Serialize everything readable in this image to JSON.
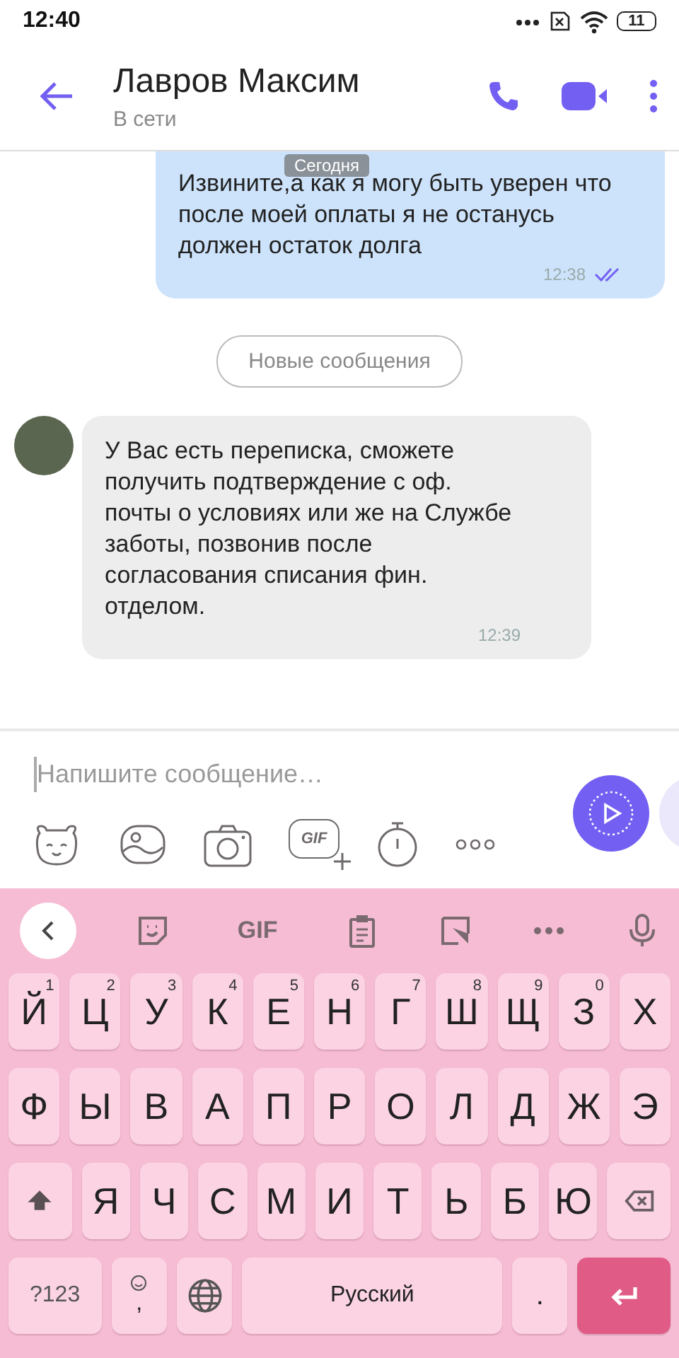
{
  "status_bar": {
    "time": "12:40",
    "battery": "11"
  },
  "header": {
    "title": "Лавров Максим",
    "subtitle": "В сети"
  },
  "date_badge": "Сегодня",
  "messages": [
    {
      "kind": "outgoing",
      "text": "Извините,а как я могу быть уверен что после моей оплаты я не останусь должен остаток долга",
      "time": "12:38",
      "read": true
    },
    {
      "kind": "divider",
      "text": "Новые сообщения"
    },
    {
      "kind": "incoming",
      "text": "У Вас есть переписка, сможете получить подтверждение с оф. почты о условиях или же на Службе заботы, позвонив после согласования списания фин. отделом.",
      "time": "12:39"
    }
  ],
  "composer": {
    "placeholder": "Напишите сообщение…",
    "gif_label": "GIF"
  },
  "keyboard": {
    "toolbar_gif": "GIF",
    "rows": [
      {
        "keys": [
          {
            "kind": "char",
            "label": "Й",
            "hint": "1"
          },
          {
            "kind": "char",
            "label": "Ц",
            "hint": "2"
          },
          {
            "kind": "char",
            "label": "У",
            "hint": "3"
          },
          {
            "kind": "char",
            "label": "К",
            "hint": "4"
          },
          {
            "kind": "char",
            "label": "Е",
            "hint": "5"
          },
          {
            "kind": "char",
            "label": "Н",
            "hint": "6"
          },
          {
            "kind": "char",
            "label": "Г",
            "hint": "7"
          },
          {
            "kind": "char",
            "label": "Ш",
            "hint": "8"
          },
          {
            "kind": "char",
            "label": "Щ",
            "hint": "9"
          },
          {
            "kind": "char",
            "label": "З",
            "hint": "0"
          },
          {
            "kind": "char",
            "label": "Х"
          }
        ]
      },
      {
        "keys": [
          {
            "kind": "char",
            "label": "Ф"
          },
          {
            "kind": "char",
            "label": "Ы"
          },
          {
            "kind": "char",
            "label": "В"
          },
          {
            "kind": "char",
            "label": "А"
          },
          {
            "kind": "char",
            "label": "П"
          },
          {
            "kind": "char",
            "label": "Р"
          },
          {
            "kind": "char",
            "label": "О"
          },
          {
            "kind": "char",
            "label": "Л"
          },
          {
            "kind": "char",
            "label": "Д"
          },
          {
            "kind": "char",
            "label": "Ж"
          },
          {
            "kind": "char",
            "label": "Э"
          }
        ]
      },
      {
        "keys": [
          {
            "kind": "shift"
          },
          {
            "kind": "char",
            "label": "Я"
          },
          {
            "kind": "char",
            "label": "Ч"
          },
          {
            "kind": "char",
            "label": "С"
          },
          {
            "kind": "char",
            "label": "М"
          },
          {
            "kind": "char",
            "label": "И"
          },
          {
            "kind": "char",
            "label": "Т"
          },
          {
            "kind": "char",
            "label": "Ь"
          },
          {
            "kind": "char",
            "label": "Б"
          },
          {
            "kind": "char",
            "label": "Ю"
          },
          {
            "kind": "backspace"
          }
        ]
      },
      {
        "keys": [
          {
            "kind": "symbols",
            "label": "?123"
          },
          {
            "kind": "emoji",
            "label": ","
          },
          {
            "kind": "globe"
          },
          {
            "kind": "space",
            "label": "Русский"
          },
          {
            "kind": "period",
            "label": "."
          },
          {
            "kind": "enter"
          }
        ]
      }
    ]
  }
}
